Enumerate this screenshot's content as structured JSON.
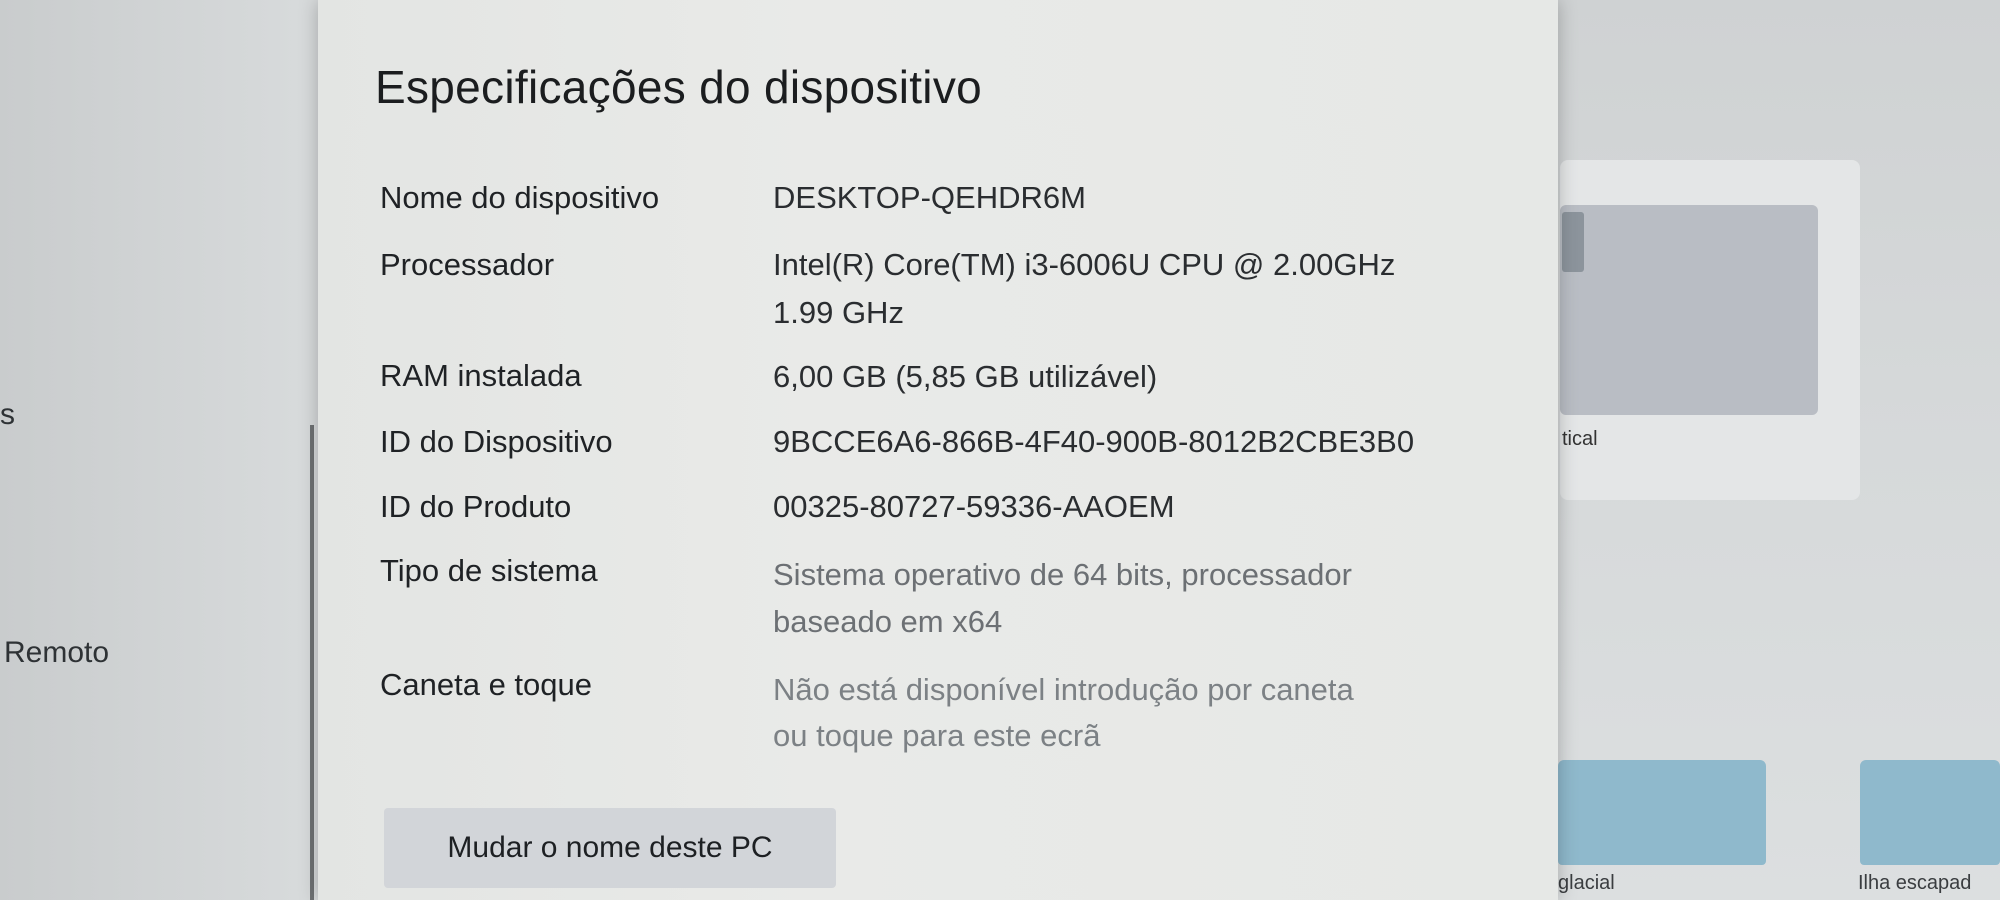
{
  "left_panel": {
    "fragment_1": "s",
    "fragment_2": "Remoto"
  },
  "dialog": {
    "title": "Especificações do dispositivo",
    "specs": [
      {
        "label": "Nome do dispositivo",
        "value": "DESKTOP-QEHDR6M",
        "value_line2": ""
      },
      {
        "label": "Processador",
        "value": "Intel(R) Core(TM) i3-6006U CPU @ 2.00GHz",
        "value_line2": "1.99 GHz"
      },
      {
        "label": "RAM instalada",
        "value": "6,00 GB (5,85 GB utilizável)",
        "value_line2": ""
      },
      {
        "label": "ID do Dispositivo",
        "value": "9BCCE6A6-866B-4F40-900B-8012B2CBE3B0",
        "value_line2": ""
      },
      {
        "label": "ID do Produto",
        "value": "00325-80727-59336-AAOEM",
        "value_line2": ""
      },
      {
        "label": "Tipo de sistema",
        "value": "Sistema operativo de 64 bits, processador",
        "value_line2": "baseado em x64"
      },
      {
        "label": "Caneta e toque",
        "value": "Não está disponível introdução por caneta",
        "value_line2": "ou toque para este ecrã"
      }
    ],
    "rename_button_label": "Mudar o nome deste PC"
  },
  "right_panel": {
    "thumb_label": "tical",
    "folder_labels": [
      "glacial",
      "Ilha escapad"
    ]
  }
}
